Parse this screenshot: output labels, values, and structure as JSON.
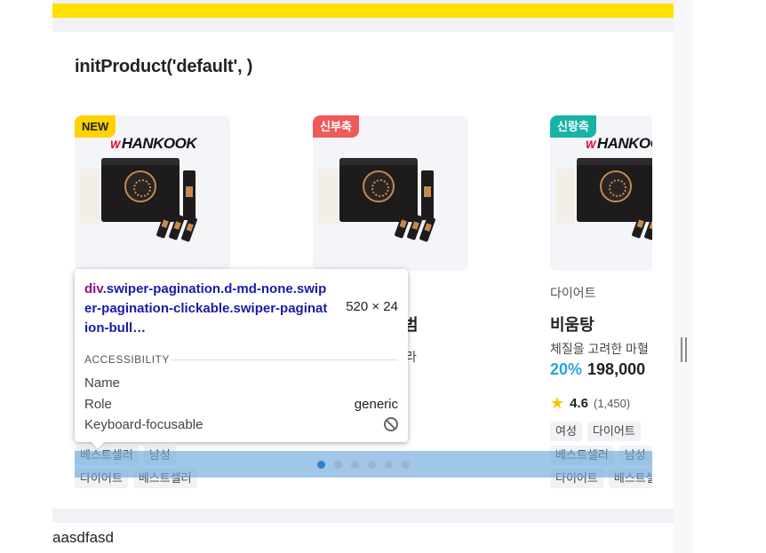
{
  "section": {
    "title": "initProduct('default', )"
  },
  "products": [
    {
      "badge": "NEW",
      "brand_logo": "HANKOOK",
      "category": "",
      "name": "",
      "description": "",
      "discount": "",
      "price": "",
      "rating": "",
      "review_count": "",
      "tags_row1": [
        "베스트셀러",
        "남성"
      ],
      "tags_row2": [
        "다이어트",
        "베스트셀러"
      ]
    },
    {
      "badge": "신부축",
      "brand_logo": "HANKOOK",
      "category": "",
      "name_fragment": "범",
      "desc_fragment": "라",
      "tags_row1": [],
      "tags_row2": []
    },
    {
      "badge": "신랑측",
      "brand_logo": "HANKOOK",
      "category": "다이어트",
      "name": "비움탕",
      "description": "체질을 고려한 마혈",
      "discount": "20%",
      "price": "198,000",
      "rating": "4.6",
      "review_count": "(1,450)",
      "tags_row0": [
        "여성",
        "다이어트"
      ],
      "tags_row1": [
        "베스트셀러",
        "남성"
      ],
      "tags_row2": [
        "다이어트",
        "베스트셀"
      ]
    }
  ],
  "pagination": {
    "bullet_count": 6,
    "active_index": 0
  },
  "tooltip": {
    "selector_tag": "div",
    "selector_rest": ".swiper-pagination.d-md-none.swiper-pagination-clickable.swiper-pagination-bull…",
    "size": "520 × 24",
    "accessibility_heading": "ACCESSIBILITY",
    "name_label": "Name",
    "role_label": "Role",
    "role_value": "generic",
    "focusable_label": "Keyboard-focusable",
    "focusable_icon": "not-allowed-icon"
  },
  "below": {
    "text": "aasdfasd"
  },
  "colors": {
    "yellow_bar": "#ffe100",
    "highlight": "#6fa8dc",
    "accent_price": "#2aa5e0",
    "badge_new": "#ffd200",
    "badge_red": "#ee5a5a",
    "badge_teal": "#17b3a6"
  }
}
